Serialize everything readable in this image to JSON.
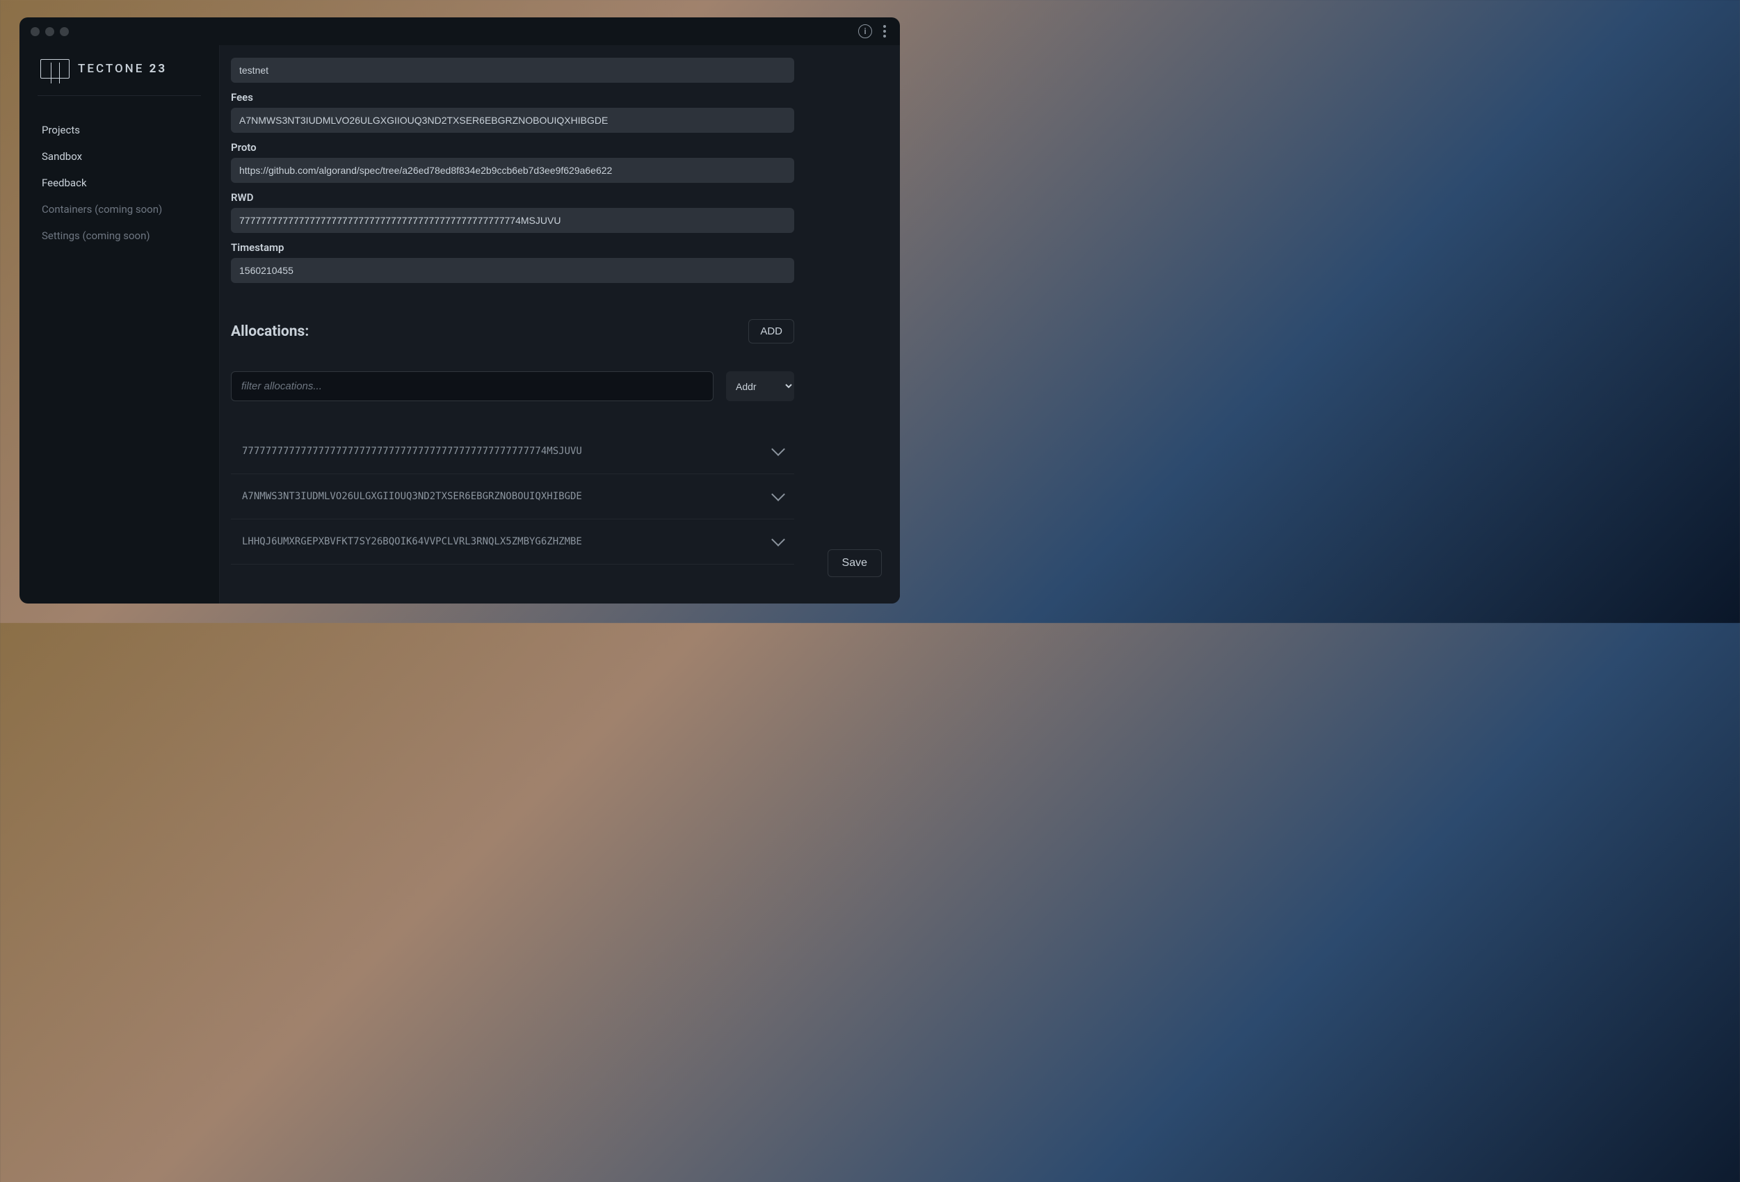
{
  "logo": {
    "text_main": "TECTONE",
    "text_accent": "23"
  },
  "sidebar": {
    "items": [
      {
        "label": "Projects",
        "disabled": false
      },
      {
        "label": "Sandbox",
        "disabled": false
      },
      {
        "label": "Feedback",
        "disabled": false
      },
      {
        "label": "Containers (coming soon)",
        "disabled": true
      },
      {
        "label": "Settings (coming soon)",
        "disabled": true
      }
    ]
  },
  "form": {
    "network": {
      "value": "testnet"
    },
    "fees": {
      "label": "Fees",
      "value": "A7NMWS3NT3IUDMLVO26ULGXGIIOUQ3ND2TXSER6EBGRZNOBOUIQXHIBGDE"
    },
    "proto": {
      "label": "Proto",
      "value": "https://github.com/algorand/spec/tree/a26ed78ed8f834e2b9ccb6eb7d3ee9f629a6e622"
    },
    "rwd": {
      "label": "RWD",
      "value": "7777777777777777777777777777777777777777777777777774MSJUVU"
    },
    "timestamp": {
      "label": "Timestamp",
      "value": "1560210455"
    }
  },
  "allocations": {
    "title": "Allocations:",
    "add_button": "ADD",
    "filter_placeholder": "filter allocations...",
    "sort_selected": "Addr",
    "items": [
      {
        "addr": "7777777777777777777777777777777777777777777777777774MSJUVU"
      },
      {
        "addr": "A7NMWS3NT3IUDMLVO26ULGXGIIOUQ3ND2TXSER6EBGRZNOBOUIQXHIBGDE"
      },
      {
        "addr": "LHHQJ6UMXRGEPXBVFKT7SY26BQOIK64VVPCLVRL3RNQLX5ZMBYG6ZHZMBE"
      }
    ]
  },
  "save_button": "Save"
}
